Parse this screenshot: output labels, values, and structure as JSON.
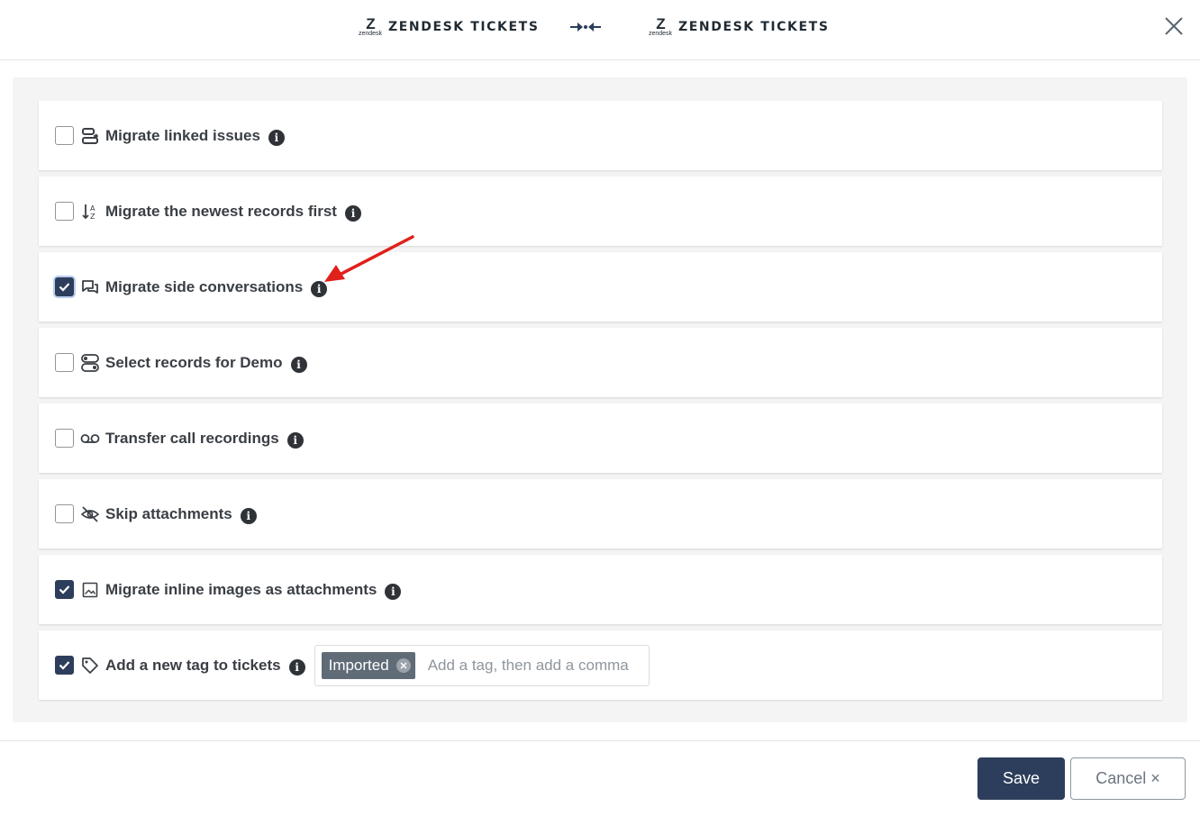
{
  "header": {
    "source": {
      "logo_word": "zendesk",
      "title": "ZENDESK TICKETS"
    },
    "target": {
      "logo_word": "zendesk",
      "title": "ZENDESK TICKETS"
    }
  },
  "options": [
    {
      "label": "Migrate linked issues",
      "checked": false,
      "icon": "linked-issues-icon"
    },
    {
      "label": "Migrate the newest records first",
      "checked": false,
      "icon": "sort-icon"
    },
    {
      "label": "Migrate side conversations",
      "checked": true,
      "icon": "conversations-icon"
    },
    {
      "label": "Select records for Demo",
      "checked": false,
      "icon": "records-toggle-icon"
    },
    {
      "label": "Transfer call recordings",
      "checked": false,
      "icon": "voicemail-icon"
    },
    {
      "label": "Skip attachments",
      "checked": false,
      "icon": "hidden-eye-icon"
    },
    {
      "label": "Migrate inline images as attachments",
      "checked": true,
      "icon": "image-icon"
    },
    {
      "label": "Add a new tag to tickets",
      "checked": true,
      "icon": "tag-icon"
    }
  ],
  "tags": {
    "chips": [
      "Imported"
    ],
    "placeholder": "Add a tag, then add a comma"
  },
  "footer": {
    "save_label": "Save",
    "cancel_label": "Cancel ×"
  },
  "colors": {
    "primary": "#2d3e5c",
    "annotation": "#e0201b",
    "panel_bg": "#f4f4f5"
  }
}
